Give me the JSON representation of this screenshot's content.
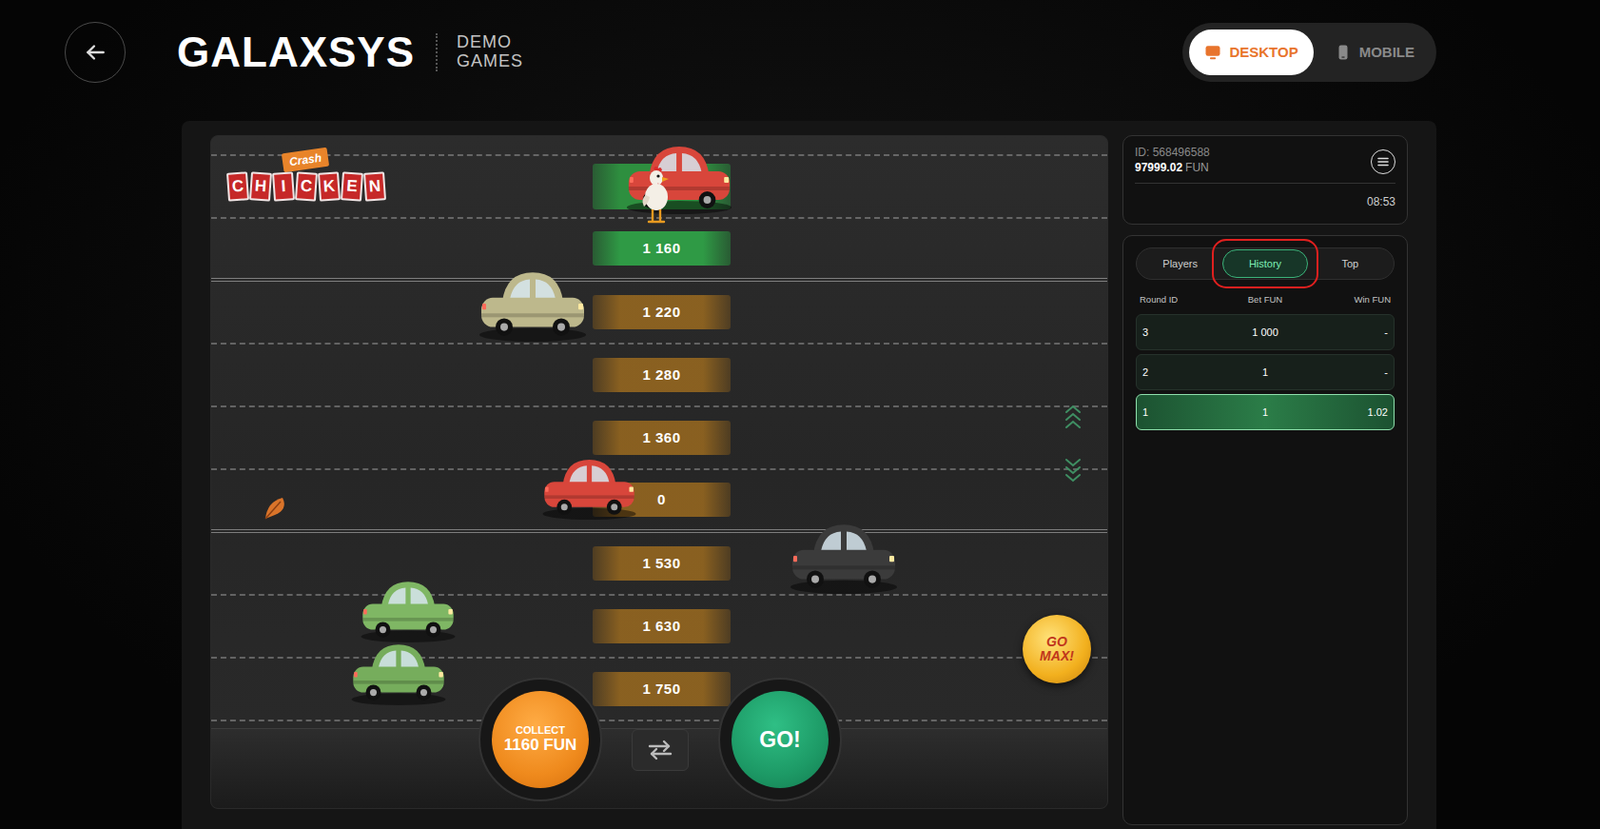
{
  "header": {
    "logo": "GALAXSYS",
    "subtitle_line1": "DEMO",
    "subtitle_line2": "GAMES"
  },
  "device_tabs": [
    {
      "label": "DESKTOP",
      "selected": true
    },
    {
      "label": "MOBILE",
      "selected": false
    }
  ],
  "game": {
    "logo_tag": "Crash",
    "logo_title": "CHICKEN",
    "lanes": [
      {
        "kind": "start"
      },
      {
        "kind": "current",
        "multiplier": "1 160"
      },
      {
        "kind": "next",
        "multiplier": "1 220"
      },
      {
        "kind": "next",
        "multiplier": "1 280"
      },
      {
        "kind": "next",
        "multiplier": "1 360"
      },
      {
        "kind": "next",
        "multiplier": "0"
      },
      {
        "kind": "next",
        "multiplier": "1 530"
      },
      {
        "kind": "next",
        "multiplier": "1 630"
      },
      {
        "kind": "next",
        "multiplier": "1 750"
      }
    ],
    "collect": {
      "label": "COLLECT",
      "amount": "1160 FUN"
    },
    "go_button": "GO!",
    "go_max": "GO MAX!"
  },
  "account": {
    "id": "ID: 568496588",
    "balance": "97999.02",
    "currency": "FUN",
    "time": "08:53"
  },
  "panel_tabs": [
    {
      "label": "Players",
      "selected": false,
      "annotated": false
    },
    {
      "label": "History",
      "selected": true,
      "annotated": true
    },
    {
      "label": "Top",
      "selected": false,
      "annotated": false
    }
  ],
  "history": {
    "columns": [
      "Round ID",
      "Bet FUN",
      "Win FUN"
    ],
    "rows": [
      {
        "round": "3",
        "bet": "1 000",
        "win": "-",
        "won": false
      },
      {
        "round": "2",
        "bet": "1",
        "win": "-",
        "won": false
      },
      {
        "round": "1",
        "bet": "1",
        "win": "1.02",
        "won": true
      }
    ]
  }
}
